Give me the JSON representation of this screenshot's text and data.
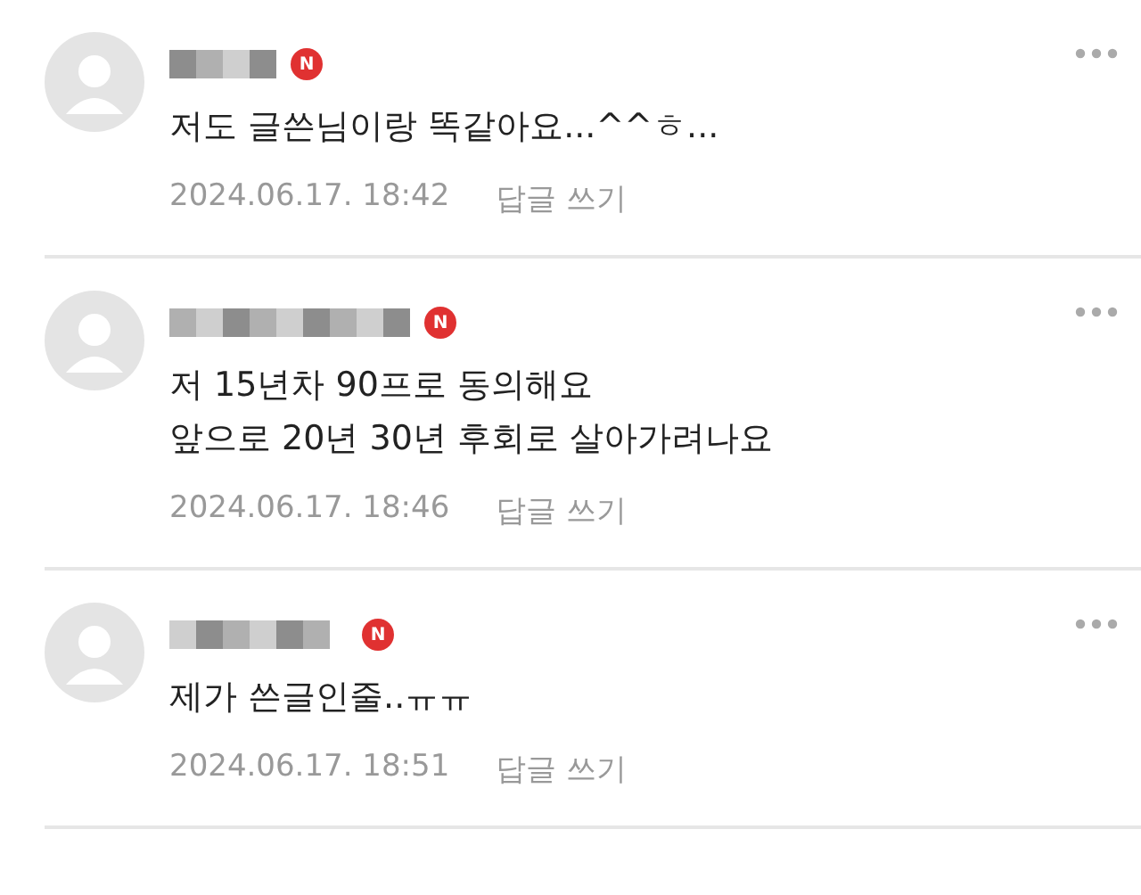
{
  "comments": [
    {
      "badge": "N",
      "lines": [
        "저도 글쓴님이랑 똑같아요...^^ㅎ..."
      ],
      "date": "2024.06.17. 18:42",
      "reply": "답글 쓰기"
    },
    {
      "badge": "N",
      "lines": [
        "저 15년차 90프로 동의해요",
        "앞으로 20년 30년 후회로 살아가려나요"
      ],
      "date": "2024.06.17. 18:46",
      "reply": "답글 쓰기"
    },
    {
      "badge": "N",
      "lines": [
        "제가 쓴글인줄..ㅠㅠ"
      ],
      "date": "2024.06.17. 18:51",
      "reply": "답글 쓰기"
    }
  ]
}
